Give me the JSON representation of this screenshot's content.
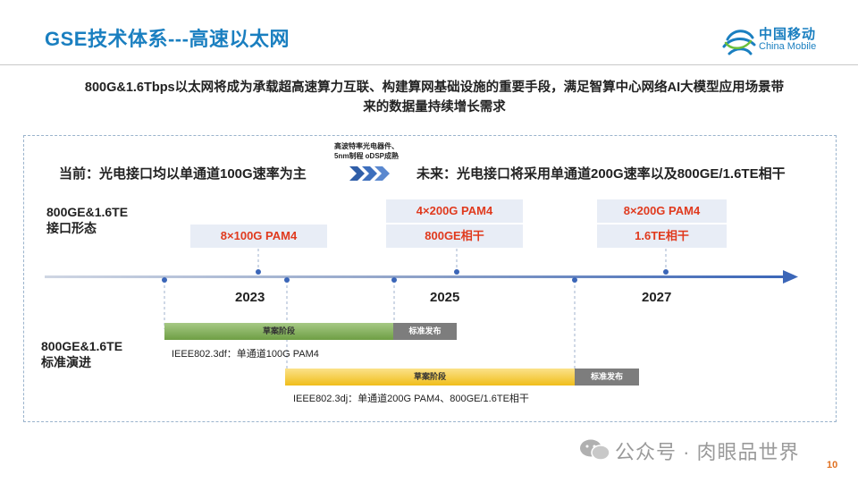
{
  "header": {
    "title": "GSE技术体系---高速以太网",
    "logo_cn": "中国移动",
    "logo_en": "China Mobile"
  },
  "intro": {
    "line1": "800G&1.6Tbps以太网将成为承载超高速算力互联、构建算网基础设施的重要手段，满足智算中心网络AI大模型应用场景带",
    "line2": "来的数据量持续增长需求"
  },
  "transition": {
    "note_line1": "高波特率光电器件、",
    "note_line2": "5nm制程 oDSP成熟",
    "current": "当前：光电接口均以单通道100G速率为主",
    "future": "未来：光电接口将采用单通道200G速率以及800GE/1.6TE相干"
  },
  "interface_row": {
    "label_line1": "800GE&1.6TE",
    "label_line2": "接口形态",
    "pill_2023": "8×100G PAM4",
    "pill_2025_top": "4×200G PAM4",
    "pill_2025_bottom": "800GE相干",
    "pill_2027_top": "8×200G PAM4",
    "pill_2027_bottom": "1.6TE相干"
  },
  "timeline": {
    "year_2023": "2023",
    "year_2025": "2025",
    "year_2027": "2027"
  },
  "standards_row": {
    "label_line1": "800GE&1.6TE",
    "label_line2": "标准演进",
    "df_draft": "草案阶段",
    "df_release": "标准发布",
    "df_caption": "IEEE802.3df：单通道100G PAM4",
    "dj_draft": "草案阶段",
    "dj_release": "标准发布",
    "dj_caption": "IEEE802.3dj：单通道200G PAM4、800GE/1.6TE相干"
  },
  "footer": {
    "watermark": "公众号 · 肉眼品世界",
    "page": "10"
  },
  "colors": {
    "title_blue": "#1a7fc0",
    "pill_text_red": "#e03a1e",
    "pill_bg": "#e8edf6",
    "timeline_blue": "#3b66b8",
    "green_draft": "#7aa94e",
    "yellow_draft": "#f0c52a",
    "release_gray": "#7d7d7d"
  }
}
